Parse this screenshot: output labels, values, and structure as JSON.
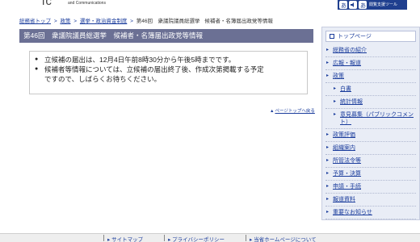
{
  "header": {
    "logo_text": "ic",
    "tagline": "and Communications",
    "tools_label": "閲覧支援ツール",
    "accent": "#1f3f8f"
  },
  "breadcrumb": {
    "items": [
      "総務省トップ",
      "政策",
      "選挙・政治資金制度"
    ],
    "sep": ">",
    "tail1": "第46回　衆議院議員総選挙",
    "tail2": "候補者・名簿届出政党等情報"
  },
  "title": "第46回　衆議院議員総選挙　候補者・名簿届出政党等情報",
  "notice": {
    "line1": "立候補の届出は、12月4日午前8時30分から午後5時までです。",
    "line2a": "候補者等情報については、立候補の届出終了後、作成次第掲載する予定",
    "line2b": "ですので、しばらくお待ちください。"
  },
  "pagetop": "ページトップへ戻る",
  "sidebar": {
    "top": "トップページ",
    "items": [
      {
        "label": "総務省の紹介",
        "sub": false
      },
      {
        "label": "広報・報道",
        "sub": false
      },
      {
        "label": "政策",
        "sub": false
      },
      {
        "label": "白書",
        "sub": true
      },
      {
        "label": "統計情報",
        "sub": true
      },
      {
        "label": "意見募集（パブリックコメント）",
        "sub": true
      },
      {
        "label": "政策評価",
        "sub": false
      },
      {
        "label": "組織案内",
        "sub": false
      },
      {
        "label": "所管法令等",
        "sub": false
      },
      {
        "label": "予算・決算",
        "sub": false
      },
      {
        "label": "申請・手続",
        "sub": false
      },
      {
        "label": "報道資料",
        "sub": false
      },
      {
        "label": "重要なお知らせ",
        "sub": false
      }
    ]
  },
  "footer": {
    "links": [
      "サイトマップ",
      "プライバシーポリシー",
      "当省ホームページについて"
    ]
  }
}
